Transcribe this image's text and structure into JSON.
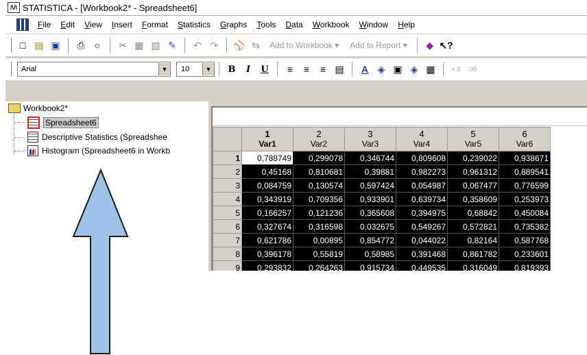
{
  "window": {
    "title": "STATISTICA - [Workbook2* - Spreadsheet6]",
    "app_icon_text": "/\\/\\"
  },
  "menubar": {
    "items": [
      "File",
      "Edit",
      "View",
      "Insert",
      "Format",
      "Statistics",
      "Graphs",
      "Tools",
      "Data",
      "Workbook",
      "Window",
      "Help"
    ]
  },
  "toolbar": {
    "add_to_workbook": "Add to Workbook",
    "add_to_report": "Add to Report"
  },
  "format_toolbar": {
    "font": "Arial",
    "size": "10",
    "bold": "B",
    "italic": "I",
    "underline": "U"
  },
  "tree": {
    "root": "Workbook2*",
    "items": [
      {
        "label": "Spreadsheet6",
        "selected": true
      },
      {
        "label": "Descriptive Statistics (Spreadshee"
      },
      {
        "label": "Histogram (Spreadsheet6 in Workb"
      }
    ]
  },
  "spreadsheet": {
    "columns": [
      {
        "num": "1",
        "name": "Var1"
      },
      {
        "num": "2",
        "name": "Var2"
      },
      {
        "num": "3",
        "name": "Var3"
      },
      {
        "num": "4",
        "name": "Var4"
      },
      {
        "num": "5",
        "name": "Var5"
      },
      {
        "num": "6",
        "name": "Var6"
      }
    ],
    "rows": [
      {
        "n": "1",
        "cells": [
          "0,788749",
          "0,299078",
          "0,346744",
          "0,809608",
          "0,239022",
          "0,938671"
        ]
      },
      {
        "n": "2",
        "cells": [
          "0,45168",
          "0,810681",
          "0,39881",
          "0,982273",
          "0,961312",
          "0,889541"
        ]
      },
      {
        "n": "3",
        "cells": [
          "0,084759",
          "0,130574",
          "0,597424",
          "0,054987",
          "0,067477",
          "0,776599"
        ]
      },
      {
        "n": "4",
        "cells": [
          "0,343919",
          "0,709356",
          "0,933901",
          "0,639734",
          "0,358609",
          "0,253973"
        ]
      },
      {
        "n": "5",
        "cells": [
          "0,166257",
          "0,121236",
          "0,365608",
          "0,394975",
          "0,68842",
          "0,450084"
        ]
      },
      {
        "n": "6",
        "cells": [
          "0,327674",
          "0,316598",
          "0,032675",
          "0,549267",
          "0,572821",
          "0,735382"
        ]
      },
      {
        "n": "7",
        "cells": [
          "0,621786",
          "0,00895",
          "0,854772",
          "0,044022",
          "0,82164",
          "0,587768"
        ]
      },
      {
        "n": "8",
        "cells": [
          "0,396178",
          "0,55819",
          "0,58985",
          "0,391468",
          "0,861782",
          "0,233601"
        ]
      },
      {
        "n": "9",
        "cells": [
          "0,293832",
          "0,264263",
          "0,915734",
          "0,449535",
          "0,316049",
          "0,819393"
        ]
      }
    ]
  },
  "colors": {
    "selected_cells_bg": "#000000",
    "arrow_fill": "#9dc3e6",
    "highlight_box": "#e02020"
  }
}
